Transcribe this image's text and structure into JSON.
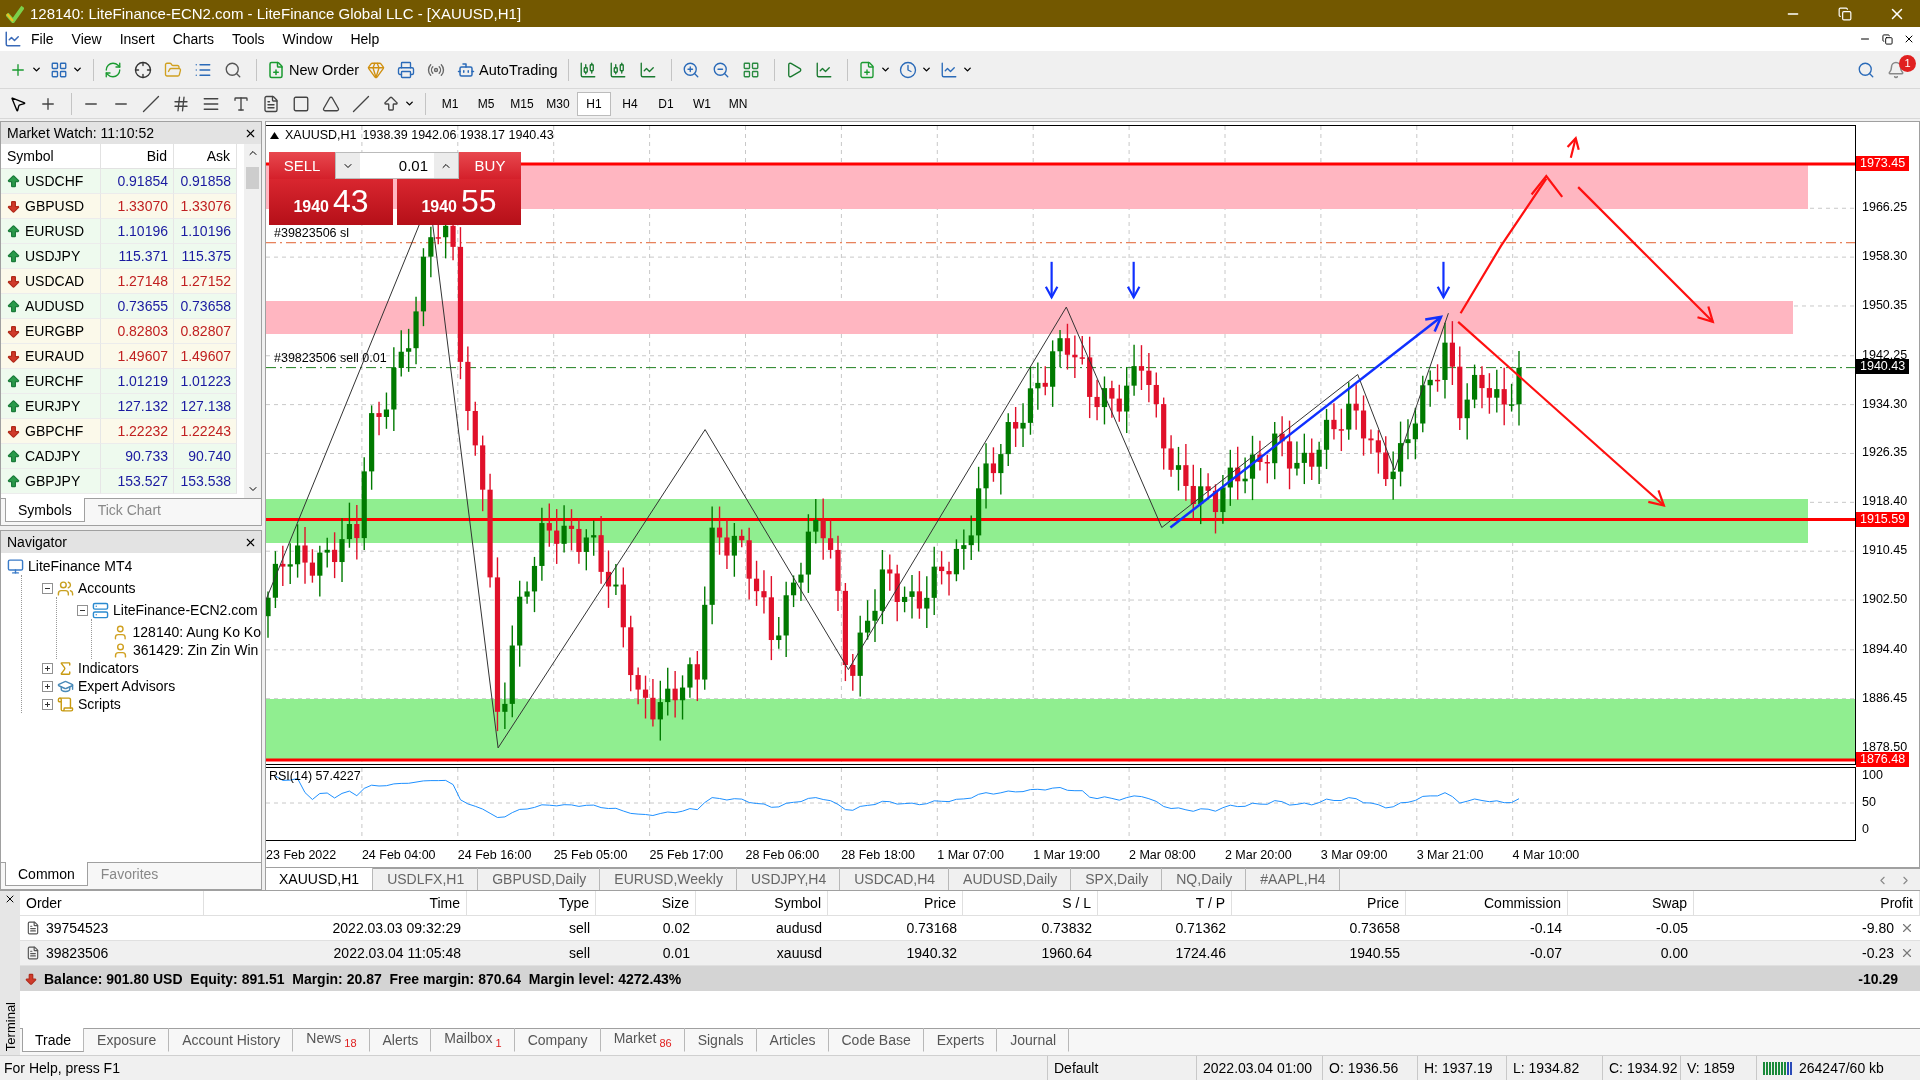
{
  "window": {
    "title": "128140: LiteFinance-ECN2.com - LiteFinance Global LLC - [XAUUSD,H1]"
  },
  "menu": [
    "File",
    "View",
    "Insert",
    "Charts",
    "Tools",
    "Window",
    "Help"
  ],
  "toolbar": {
    "new_order": "New Order",
    "autotrading": "AutoTrading",
    "notifications": "1"
  },
  "timeframes": [
    {
      "label": "M1",
      "selected": false
    },
    {
      "label": "M5",
      "selected": false
    },
    {
      "label": "M15",
      "selected": false
    },
    {
      "label": "M30",
      "selected": false
    },
    {
      "label": "H1",
      "selected": true
    },
    {
      "label": "H4",
      "selected": false
    },
    {
      "label": "D1",
      "selected": false
    },
    {
      "label": "W1",
      "selected": false
    },
    {
      "label": "MN",
      "selected": false
    }
  ],
  "market_watch": {
    "title": "Market Watch: 11:10:52",
    "columns": [
      "Symbol",
      "Bid",
      "Ask"
    ],
    "rows": [
      {
        "symbol": "USDCHF",
        "bid": "0.91854",
        "ask": "0.91858",
        "rising": true
      },
      {
        "symbol": "GBPUSD",
        "bid": "1.33070",
        "ask": "1.33076",
        "rising": false
      },
      {
        "symbol": "EURUSD",
        "bid": "1.10196",
        "ask": "1.10196",
        "rising": true
      },
      {
        "symbol": "USDJPY",
        "bid": "115.371",
        "ask": "115.375",
        "rising": true
      },
      {
        "symbol": "USDCAD",
        "bid": "1.27148",
        "ask": "1.27152",
        "rising": false
      },
      {
        "symbol": "AUDUSD",
        "bid": "0.73655",
        "ask": "0.73658",
        "rising": true
      },
      {
        "symbol": "EURGBP",
        "bid": "0.82803",
        "ask": "0.82807",
        "rising": false
      },
      {
        "symbol": "EURAUD",
        "bid": "1.49607",
        "ask": "1.49607",
        "rising": false
      },
      {
        "symbol": "EURCHF",
        "bid": "1.01219",
        "ask": "1.01223",
        "rising": true
      },
      {
        "symbol": "EURJPY",
        "bid": "127.132",
        "ask": "127.138",
        "rising": true
      },
      {
        "symbol": "GBPCHF",
        "bid": "1.22232",
        "ask": "1.22243",
        "rising": false
      },
      {
        "symbol": "CADJPY",
        "bid": "90.733",
        "ask": "90.740",
        "rising": true
      },
      {
        "symbol": "GBPJPY",
        "bid": "153.527",
        "ask": "153.538",
        "rising": true
      }
    ],
    "tabs": [
      {
        "label": "Symbols",
        "selected": true
      },
      {
        "label": "Tick Chart",
        "selected": false
      }
    ]
  },
  "navigator": {
    "title": "Navigator",
    "tree": [
      {
        "label": "LiteFinance MT4",
        "kind": "terminal",
        "children": [
          {
            "label": "Accounts",
            "kind": "accounts",
            "expanded": true,
            "children": [
              {
                "label": "LiteFinance-ECN2.com",
                "kind": "server",
                "expanded": true,
                "children": [
                  {
                    "label": "128140: Aung Ko Ko",
                    "kind": "account"
                  },
                  {
                    "label": "361429: Zin Zin Win",
                    "kind": "account"
                  }
                ]
              }
            ]
          },
          {
            "label": "Indicators",
            "kind": "indicators",
            "expanded": false
          },
          {
            "label": "Expert Advisors",
            "kind": "experts",
            "expanded": false
          },
          {
            "label": "Scripts",
            "kind": "scripts",
            "expanded": false
          }
        ]
      }
    ],
    "tabs": [
      {
        "label": "Common",
        "selected": true
      },
      {
        "label": "Favorites",
        "selected": false
      }
    ]
  },
  "chart": {
    "symbol": "XAUUSD,H1",
    "ohlc": "1938.39 1942.06 1938.17 1940.43",
    "order_labels": [
      "#39823506 sl",
      "#39823506 sell 0.01"
    ],
    "trade_panel": {
      "sell": "SELL",
      "buy": "BUY",
      "volume": "0.01",
      "bid_prefix": "1940",
      "bid_pips": "43",
      "ask_prefix": "1940",
      "ask_pips": "55"
    },
    "yticks": [
      "1966.25",
      "1958.30",
      "1950.35",
      "1942.25",
      "1934.30",
      "1926.35",
      "1918.40",
      "1910.45",
      "1902.50",
      "1894.40",
      "1886.45",
      "1878.50"
    ],
    "price_tags": [
      {
        "label": "1973.45",
        "kind": "level"
      },
      {
        "label": "1940.43",
        "kind": "bid"
      },
      {
        "label": "1915.59",
        "kind": "level"
      },
      {
        "label": "1876.48",
        "kind": "level"
      }
    ],
    "indicator": {
      "label": "RSI(14) 57.4227",
      "ticks": [
        "100",
        "50",
        "0"
      ]
    },
    "time_labels": [
      "23 Feb 2022",
      "24 Feb 04:00",
      "24 Feb 16:00",
      "25 Feb 05:00",
      "25 Feb 17:00",
      "28 Feb 06:00",
      "28 Feb 18:00",
      "1 Mar 07:00",
      "1 Mar 19:00",
      "2 Mar 08:00",
      "2 Mar 20:00",
      "3 Mar 09:00",
      "3 Mar 21:00",
      "4 Mar 10:00"
    ]
  },
  "chart_tabs": [
    {
      "label": "XAUUSD,H1",
      "selected": true
    },
    {
      "label": "USDLFX,H1",
      "selected": false
    },
    {
      "label": "GBPUSD,Daily",
      "selected": false
    },
    {
      "label": "EURUSD,Weekly",
      "selected": false
    },
    {
      "label": "USDJPY,H4",
      "selected": false
    },
    {
      "label": "USDCAD,H4",
      "selected": false
    },
    {
      "label": "AUDUSD,Daily",
      "selected": false
    },
    {
      "label": "SPX,Daily",
      "selected": false
    },
    {
      "label": "NQ,Daily",
      "selected": false
    },
    {
      "label": "#AAPL,H4",
      "selected": false
    }
  ],
  "terminal": {
    "label": "Terminal",
    "columns": [
      "Order",
      "Time",
      "Type",
      "Size",
      "Symbol",
      "Price",
      "S / L",
      "T / P",
      "Price",
      "Commission",
      "Swap",
      "Profit"
    ],
    "rows": [
      {
        "cells": [
          "39754523",
          "2022.03.03 09:32:29",
          "sell",
          "0.02",
          "audusd",
          "0.73168",
          "0.73832",
          "0.71362",
          "0.73658",
          "-0.14",
          "-0.05",
          "-9.80"
        ]
      },
      {
        "cells": [
          "39823506",
          "2022.03.04 11:05:48",
          "sell",
          "0.01",
          "xauusd",
          "1940.32",
          "1960.64",
          "1724.46",
          "1940.55",
          "-0.07",
          "0.00",
          "-0.23"
        ]
      }
    ],
    "summary": "Balance: 901.80 USD  Equity: 891.51  Margin: 20.87  Free margin: 870.64  Margin level: 4272.43%",
    "total": "-10.29",
    "tabs": [
      {
        "label": "Trade",
        "selected": true
      },
      {
        "label": "Exposure",
        "selected": false
      },
      {
        "label": "Account History",
        "selected": false
      },
      {
        "label": "News",
        "count": "18",
        "selected": false
      },
      {
        "label": "Alerts",
        "selected": false
      },
      {
        "label": "Mailbox",
        "count": "1",
        "selected": false
      },
      {
        "label": "Company",
        "selected": false
      },
      {
        "label": "Market",
        "count": "86",
        "selected": false
      },
      {
        "label": "Signals",
        "selected": false
      },
      {
        "label": "Articles",
        "selected": false
      },
      {
        "label": "Code Base",
        "selected": false
      },
      {
        "label": "Experts",
        "selected": false
      },
      {
        "label": "Journal",
        "selected": false
      }
    ]
  },
  "status_bar": {
    "help": "For Help, press F1",
    "profile": "Default",
    "time": "2022.03.04 01:00",
    "open": "O: 1936.56",
    "high": "H: 1937.19",
    "low": "L: 1934.82",
    "close": "C: 1934.92",
    "volume": "V: 1859",
    "traffic": "264247/60 kb"
  }
}
